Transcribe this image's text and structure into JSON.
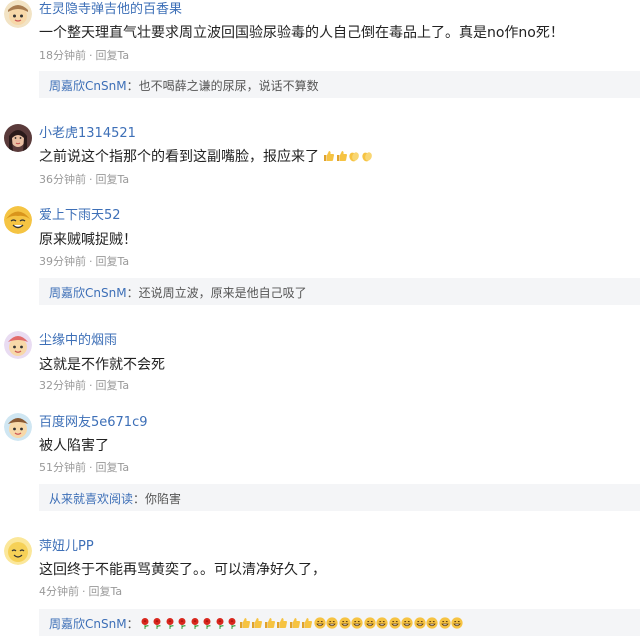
{
  "comments": [
    {
      "username": "在灵隐寺弹吉他的百香果",
      "text": "一个整天理直气壮要求周立波回国验尿验毒的人自己倒在毒品上了。真是no作no死！",
      "time": "18分钟前",
      "reply_label": "回复Ta",
      "avatar_icon": "cartoon-face-avatar",
      "reply": {
        "name": "周嘉欣CnSnM",
        "text": "：也不喝薛之谦的尿尿，说话不算数"
      }
    },
    {
      "username": "小老虎1314521",
      "text": "之前说这个指那个的看到这副嘴脸，报应来了",
      "emojis": [
        "thumbs-up",
        "thumbs-up",
        "clap",
        "clap"
      ],
      "time": "36分钟前",
      "reply_label": "回复Ta",
      "avatar_icon": "photo-avatar"
    },
    {
      "username": "爱上下雨天52",
      "text": "原来贼喊捉贼！",
      "time": "39分钟前",
      "reply_label": "回复Ta",
      "avatar_icon": "smiley-avatar",
      "reply": {
        "name": "周嘉欣CnSnM",
        "text": "：还说周立波，原来是他自己吸了"
      }
    },
    {
      "username": "尘缘中的烟雨",
      "text": "这就是不作就不会死",
      "time": "32分钟前",
      "reply_label": "回复Ta",
      "avatar_icon": "cartoon-face-avatar"
    },
    {
      "username": "百度网友5e671c9",
      "text": "被人陷害了",
      "time": "51分钟前",
      "reply_label": "回复Ta",
      "avatar_icon": "cartoon-face-avatar",
      "reply": {
        "name": "从来就喜欢阅读",
        "text": "：你陷害"
      }
    },
    {
      "username": "萍妞儿PP",
      "text": "这回终于不能再骂黄奕了。。可以清净好久了，",
      "time": "4分钟前",
      "reply_label": "回复Ta",
      "avatar_icon": "smiley-avatar",
      "reply": {
        "name": "周嘉欣CnSnM",
        "text": "：",
        "emojis": [
          "rose",
          "rose",
          "rose",
          "rose",
          "rose",
          "rose",
          "rose",
          "rose",
          "thumbs-up",
          "thumbs-up",
          "thumbs-up",
          "thumbs-up",
          "thumbs-up",
          "thumbs-up",
          "grin",
          "grin",
          "grin",
          "grin",
          "grin",
          "grin",
          "grin",
          "grin",
          "grin",
          "grin",
          "grin",
          "grin"
        ]
      }
    }
  ],
  "separator": "·",
  "colors": {
    "link": "#3d6fb7",
    "meta": "#999999",
    "reply_bg": "#f4f5f7"
  }
}
